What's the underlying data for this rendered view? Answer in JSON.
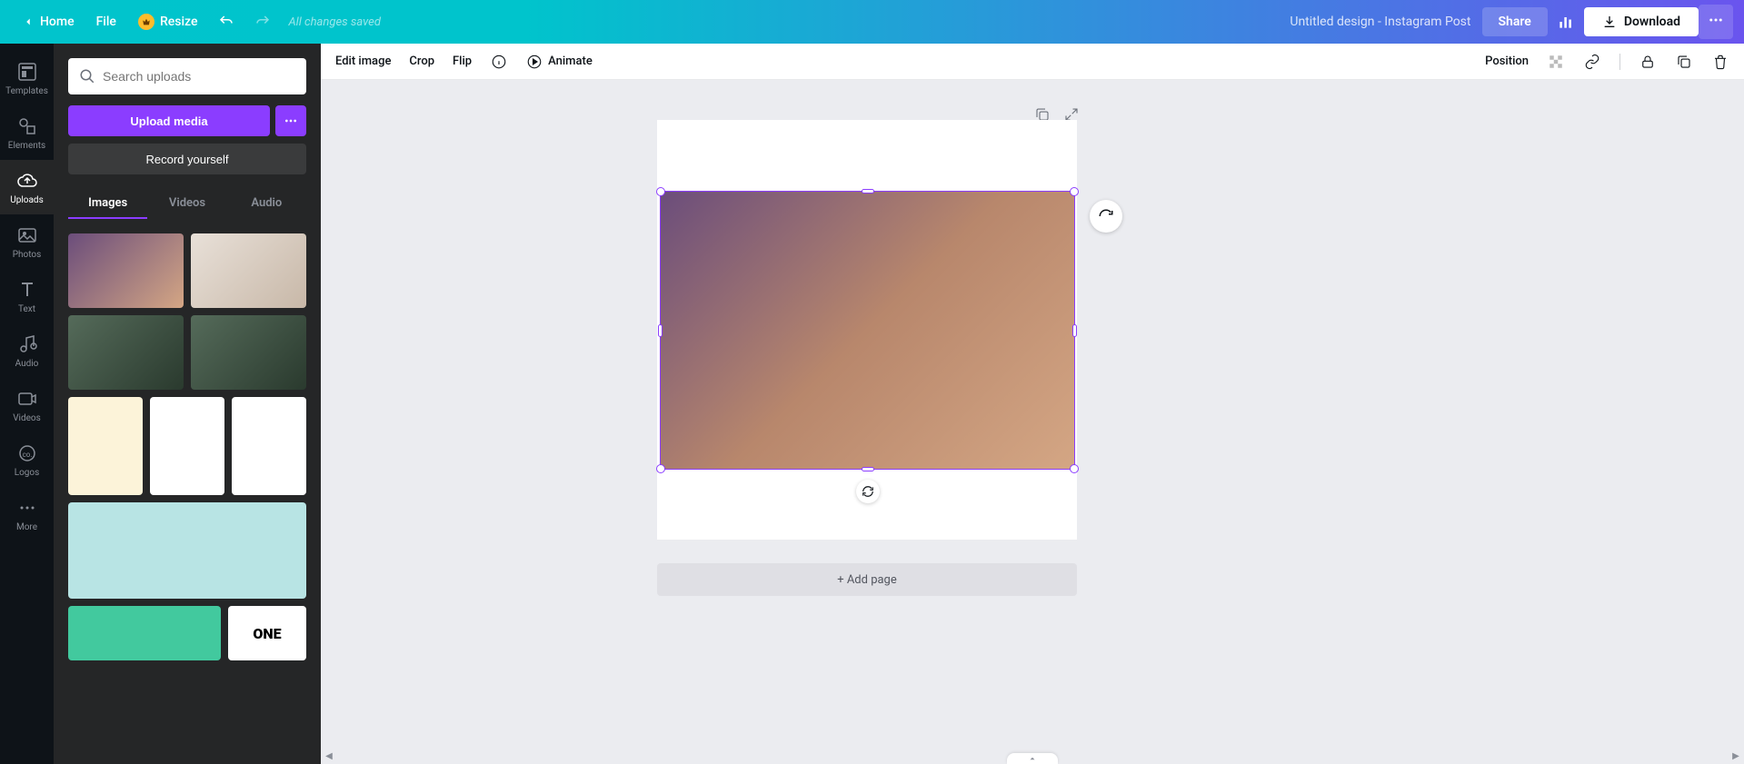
{
  "top": {
    "home": "Home",
    "file": "File",
    "resize": "Resize",
    "saved": "All changes saved",
    "title": "Untitled design - Instagram Post",
    "share": "Share",
    "download": "Download"
  },
  "rail": {
    "templates": "Templates",
    "elements": "Elements",
    "uploads": "Uploads",
    "photos": "Photos",
    "text": "Text",
    "audio": "Audio",
    "videos": "Videos",
    "logos": "Logos",
    "more": "More"
  },
  "panel": {
    "search_placeholder": "Search uploads",
    "upload": "Upload media",
    "record": "Record yourself",
    "tabs": {
      "images": "Images",
      "videos": "Videos",
      "audio": "Audio"
    },
    "one_label": "ONE"
  },
  "imgbar": {
    "edit": "Edit image",
    "crop": "Crop",
    "flip": "Flip",
    "animate": "Animate",
    "position": "Position"
  },
  "canvas": {
    "add_page": "+ Add page"
  }
}
